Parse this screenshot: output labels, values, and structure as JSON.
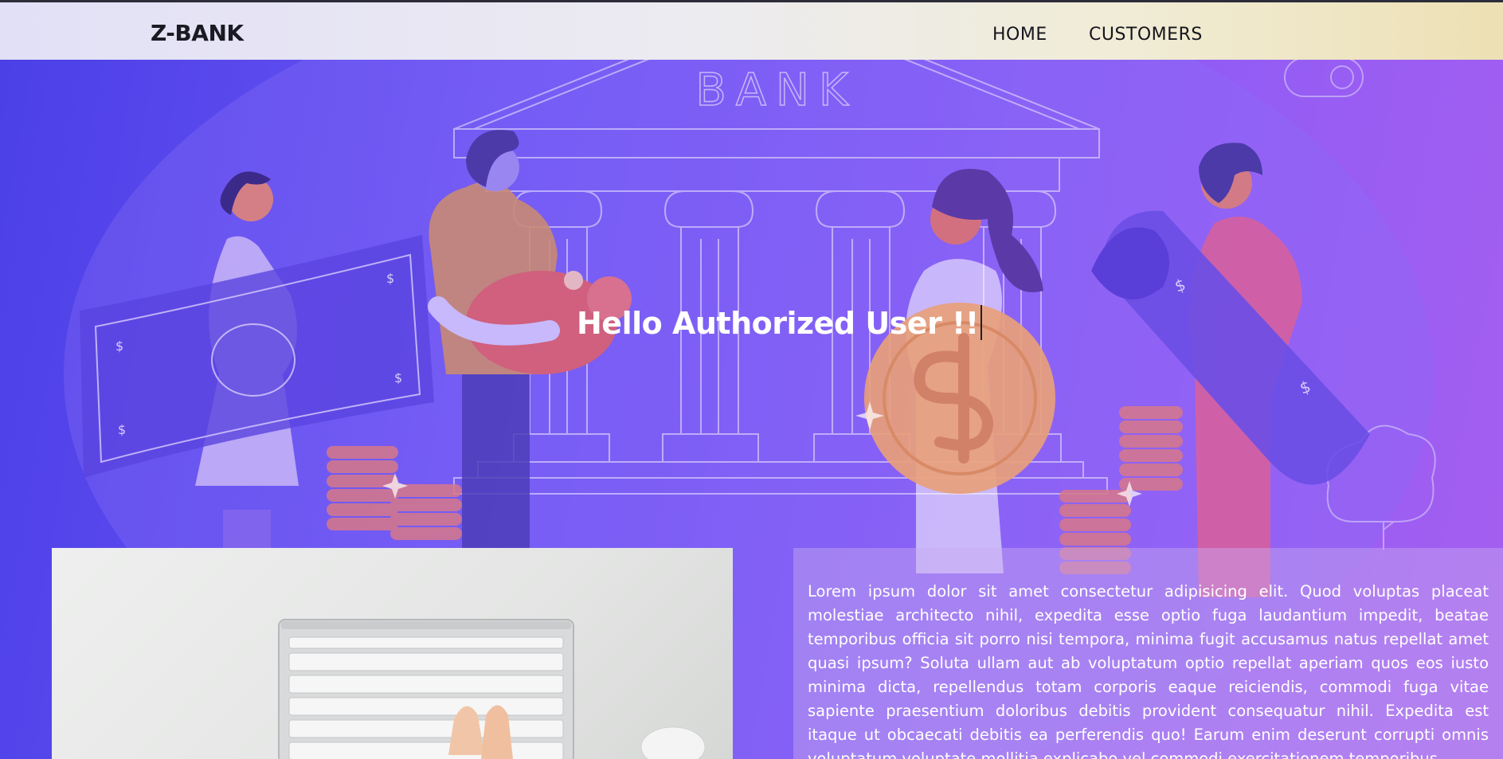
{
  "navbar": {
    "brand": "Z-BANK",
    "links": [
      "HOME",
      "CUSTOMERS"
    ]
  },
  "hero": {
    "heading": "Hello Authorized User !!",
    "bank_sign": "BANK",
    "illustration_currency_symbol": "$"
  },
  "content": {
    "body_text": "Lorem ipsum dolor sit amet consectetur adipisicing elit. Quod voluptas placeat molestiae architecto nihil, expedita esse optio fuga laudantium impedit, beatae temporibus officia sit porro nisi tempora, minima fugit accusamus natus repellat amet quasi ipsum? Soluta ullam aut ab voluptatum optio repellat aperiam quos eos iusto minima dicta, repellendus totam corporis eaque reiciendis, commodi fuga vitae sapiente praesentium doloribus debitis provident consequatur nihil. Expedita est itaque ut obcaecati debitis ea perferendis quo! Earum enim deserunt corrupti omnis voluptatum voluptate mollitia explicabo vel commodi exercitationem temporibus"
  },
  "colors": {
    "hero_gradient_start": "#4a3fe6",
    "hero_gradient_end": "#a55ef0",
    "navbar_start": "#e2e0f6",
    "navbar_end": "#ede0b4",
    "accent_pink": "#e0607a",
    "coin": "#e8a07a"
  }
}
